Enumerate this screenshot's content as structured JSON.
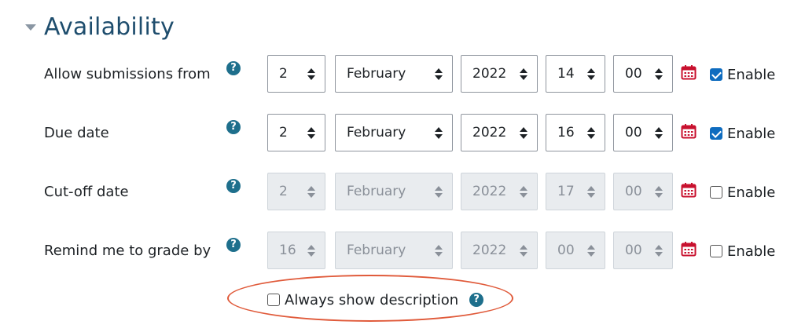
{
  "section": {
    "title": "Availability"
  },
  "help_glyph": "?",
  "enable_label": "Enable",
  "rows": [
    {
      "label": "Allow submissions from",
      "day": "2",
      "month": "February",
      "year": "2022",
      "hour": "14",
      "minute": "00",
      "enabled": true
    },
    {
      "label": "Due date",
      "day": "2",
      "month": "February",
      "year": "2022",
      "hour": "16",
      "minute": "00",
      "enabled": true
    },
    {
      "label": "Cut-off date",
      "day": "2",
      "month": "February",
      "year": "2022",
      "hour": "17",
      "minute": "00",
      "enabled": false
    },
    {
      "label": "Remind me to grade by",
      "day": "16",
      "month": "February",
      "year": "2022",
      "hour": "00",
      "minute": "00",
      "enabled": false
    }
  ],
  "always_show_description": {
    "label": "Always show description",
    "checked": false
  },
  "colors": {
    "heading": "#1e4d6d",
    "help_icon": "#1e6f8c",
    "calendar_icon": "#c8102e",
    "checkbox_checked": "#0f6cbf",
    "highlight_oval": "#e05a3a"
  },
  "icons": {
    "caret": "caret-down-icon",
    "help": "question-circle-icon",
    "calendar": "calendar-icon"
  }
}
